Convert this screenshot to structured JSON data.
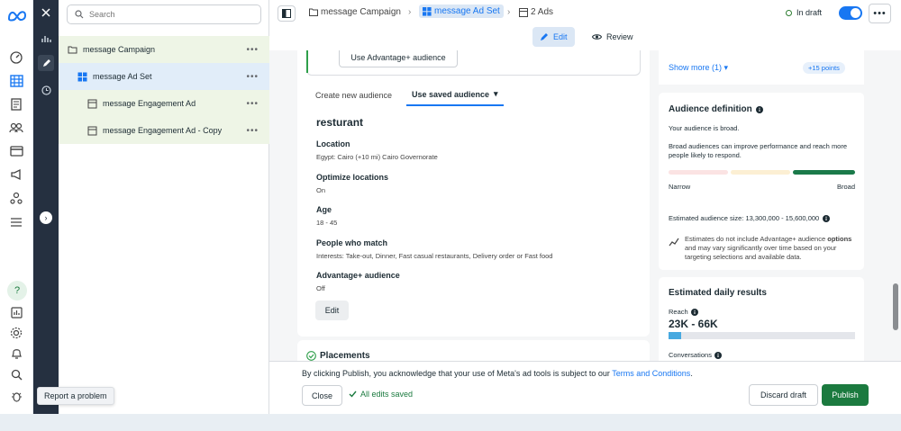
{
  "search": {
    "placeholder": "Search"
  },
  "tree": {
    "campaign": "message Campaign",
    "adset": "message Ad Set",
    "ads": [
      "message Engagement Ad",
      "message Engagement Ad - Copy"
    ],
    "more": "•••"
  },
  "tooltip": "Report a problem",
  "breadcrumb": {
    "campaign": "message Campaign",
    "adset": "message Ad Set",
    "ads": "2 Ads",
    "sep": "›"
  },
  "status": {
    "draft": "In draft",
    "more": "•••"
  },
  "mode": {
    "edit": "Edit",
    "review": "Review"
  },
  "audience": {
    "use_advantage": "Use Advantage+ audience",
    "tab_create": "Create new audience",
    "tab_saved": "Use saved audience",
    "name": "resturant",
    "fields": [
      {
        "label": "Location",
        "value": "Egypt: Cairo (+10 mi) Cairo Governorate"
      },
      {
        "label": "Optimize locations",
        "value": "On"
      },
      {
        "label": "Age",
        "value": "18 - 45"
      },
      {
        "label": "People who match",
        "value": "Interests: Take-out, Dinner, Fast casual restaurants, Delivery order or Fast food"
      },
      {
        "label": "Advantage+ audience",
        "value": "Off"
      }
    ],
    "edit": "Edit"
  },
  "placements": {
    "title": "Placements"
  },
  "right": {
    "show_more": "Show more (1)",
    "points": "+15 points",
    "definition_title": "Audience definition",
    "broad_text": "Your audience is broad.",
    "broad_desc": "Broad audiences can improve performance and reach more people likely to respond.",
    "narrow": "Narrow",
    "broad": "Broad",
    "est_size": "Estimated audience size: 13,300,000 - 15,600,000",
    "est_note_pre": "Estimates do not include Advantage+ audience ",
    "est_note_link": "options",
    "est_note_post": " and may vary significantly over time based on your targeting selections and available data.",
    "results_title": "Estimated daily results",
    "reach_label": "Reach",
    "reach_value": "23K - 66K",
    "reach_fraction": 0.07,
    "conversations_label": "Conversations"
  },
  "footer": {
    "pre": "By clicking ",
    "publish_word": "Publish",
    "mid": ", you acknowledge that your use of Meta's ad tools is subject to our ",
    "terms": "Terms and Conditions",
    "end": ".",
    "close": "Close",
    "saved": "All edits saved",
    "discard": "Discard draft",
    "publish": "Publish"
  },
  "colors": {
    "accent": "#1877f2",
    "publish": "#1b7a3f",
    "dark_rail": "#253040"
  }
}
